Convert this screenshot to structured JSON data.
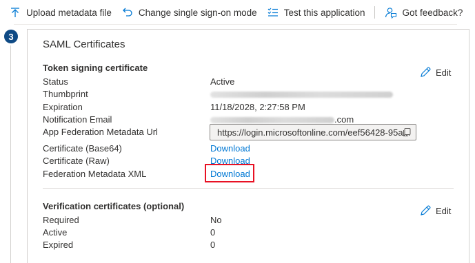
{
  "toolbar": {
    "upload_label": "Upload metadata file",
    "change_sso_label": "Change single sign-on mode",
    "test_label": "Test this application",
    "feedback_label": "Got feedback?"
  },
  "step": {
    "number": "3"
  },
  "card": {
    "title": "SAML Certificates",
    "token_section": {
      "title": "Token signing certificate",
      "edit_label": "Edit",
      "status_label": "Status",
      "status_value": "Active",
      "thumbprint_label": "Thumbprint",
      "expiration_label": "Expiration",
      "expiration_value": "11/18/2028, 2:27:58 PM",
      "notification_email_label": "Notification Email",
      "notification_email_suffix": ".com",
      "metadata_url_label": "App Federation Metadata Url",
      "metadata_url_value": "https://login.microsoftonline.com/eef56428-95a...",
      "cert_base64_label": "Certificate (Base64)",
      "cert_base64_link": "Download",
      "cert_raw_label": "Certificate (Raw)",
      "cert_raw_link": "Download",
      "fed_xml_label": "Federation Metadata XML",
      "fed_xml_link": "Download"
    },
    "verification_section": {
      "title": "Verification certificates (optional)",
      "edit_label": "Edit",
      "required_label": "Required",
      "required_value": "No",
      "active_label": "Active",
      "active_value": "0",
      "expired_label": "Expired",
      "expired_value": "0"
    }
  },
  "colors": {
    "link": "#0078d4",
    "badge": "#0f4a85",
    "highlight": "#e81123",
    "text": "#323130"
  },
  "icons": {
    "upload": "upload-icon",
    "change_sso": "change-sso-icon",
    "test": "test-list-icon",
    "feedback": "feedback-icon",
    "edit": "pencil-icon",
    "copy": "copy-icon"
  }
}
